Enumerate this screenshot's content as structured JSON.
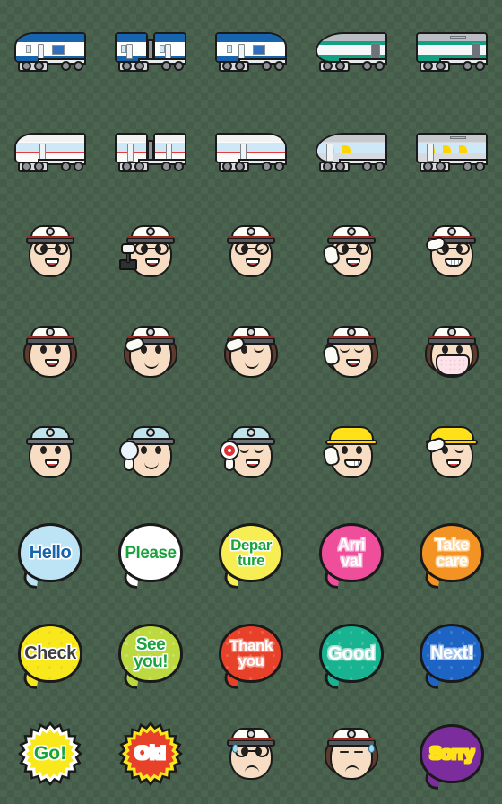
{
  "sheet": {
    "title": "Train & Station Staff Emoji Sticker Sheet",
    "columns": 5,
    "rows": 8,
    "cell_size_px": 112,
    "background": "transparent-checkerboard"
  },
  "palette": {
    "outline": "#1a1a1a",
    "train_blue": "#1663ae",
    "train_teal": "#13a184",
    "train_red_stripe": "#e33b3b",
    "cap_white": "#fdfdf7",
    "cap_blue": "#bfe4ec",
    "helmet_yellow": "#ffe11a",
    "skin": "#f7ddc3",
    "hair_brown": "#5e3b2c",
    "bubble_hello": "#bde4f4",
    "bubble_please": "#ffffff",
    "bubble_departure": "#f6ee52",
    "bubble_arrival": "#ef4e9b",
    "bubble_takecare": "#f39324",
    "bubble_check": "#f8e81c",
    "bubble_seeyou": "#bcd93f",
    "bubble_thankyou": "#e8412a",
    "bubble_good": "#18b391",
    "bubble_next": "#1d64c4",
    "badge_go": "#f8e81c",
    "badge_ok": "#e8412a",
    "bubble_sorry": "#7b2d9e"
  },
  "items": [
    {
      "row": 1,
      "col": 1,
      "name": "train-blue-front-left",
      "kind": "train",
      "label": "Blue commuter train front car (facing left)",
      "body": "#ffffff",
      "roof": "#1663ae",
      "accent": "#1663ae",
      "style": "nose-left"
    },
    {
      "row": 1,
      "col": 2,
      "name": "train-blue-coupled",
      "kind": "train",
      "label": "Blue commuter train coupled cars",
      "body": "#ffffff",
      "roof": "#1663ae",
      "accent": "#1663ae",
      "style": "coupled"
    },
    {
      "row": 1,
      "col": 3,
      "name": "train-blue-front-right",
      "kind": "train",
      "label": "Blue commuter train front car (facing right)",
      "body": "#ffffff",
      "roof": "#1663ae",
      "accent": "#1663ae",
      "style": "nose-right"
    },
    {
      "row": 1,
      "col": 4,
      "name": "train-teal-express-front",
      "kind": "train",
      "label": "Teal limited express front car",
      "body": "#13a184",
      "roof": "#b9bdc1",
      "accent": "#13a184",
      "style": "bullet-left"
    },
    {
      "row": 1,
      "col": 5,
      "name": "train-teal-express-car",
      "kind": "train",
      "label": "Teal limited express middle car",
      "body": "#13a184",
      "roof": "#b9bdc1",
      "accent": "#13a184",
      "style": "plain"
    },
    {
      "row": 2,
      "col": 1,
      "name": "train-white-red-front-left",
      "kind": "train",
      "label": "White train with red stripe, front car facing left",
      "body": "#fbfbfb",
      "roof": "#f2f2f2",
      "accent": "#e33b3b",
      "style": "nose-left-slope"
    },
    {
      "row": 2,
      "col": 2,
      "name": "train-white-red-coupled",
      "kind": "train",
      "label": "White train with red stripe, coupled cars",
      "body": "#fbfbfb",
      "roof": "#f2f2f2",
      "accent": "#e33b3b",
      "style": "coupled"
    },
    {
      "row": 2,
      "col": 3,
      "name": "train-white-red-front-right",
      "kind": "train",
      "label": "White train with red stripe, front car facing right",
      "body": "#fbfbfb",
      "roof": "#f2f2f2",
      "accent": "#e33b3b",
      "style": "nose-right-slope"
    },
    {
      "row": 2,
      "col": 4,
      "name": "train-silver-subway-front",
      "kind": "train",
      "label": "Silver subway car with yellow seats, front",
      "body": "#d7dade",
      "roof": "#c6cace",
      "accent": "#ffd400",
      "style": "round-left"
    },
    {
      "row": 2,
      "col": 5,
      "name": "train-silver-subway-car",
      "kind": "train",
      "label": "Silver subway middle car with yellow seats",
      "body": "#d7dade",
      "roof": "#c6cace",
      "accent": "#ffd400",
      "style": "plain"
    },
    {
      "row": 3,
      "col": 1,
      "name": "conductor-male-smiling",
      "kind": "face",
      "label": "Male conductor with glasses, smiling",
      "gender": "male",
      "cap": "white",
      "eyes": "open",
      "mouth": "smile",
      "glasses": true,
      "prop": "none"
    },
    {
      "row": 3,
      "col": 2,
      "name": "conductor-male-driving",
      "kind": "face",
      "label": "Male conductor with glasses operating control lever",
      "gender": "male",
      "cap": "white",
      "eyes": "open",
      "mouth": "smile",
      "glasses": true,
      "prop": "lever"
    },
    {
      "row": 3,
      "col": 3,
      "name": "conductor-male-winking",
      "kind": "face",
      "label": "Male conductor with glasses, winking",
      "gender": "male",
      "cap": "white",
      "eyes": "wink",
      "mouth": "smile",
      "glasses": true,
      "prop": "none"
    },
    {
      "row": 3,
      "col": 4,
      "name": "conductor-male-pointing",
      "kind": "face",
      "label": "Male conductor with glasses, pointing and calling",
      "gender": "male",
      "cap": "white",
      "eyes": "open",
      "mouth": "smile",
      "glasses": true,
      "prop": "point"
    },
    {
      "row": 3,
      "col": 5,
      "name": "conductor-male-saluting",
      "kind": "face",
      "label": "Male conductor with glasses, saluting and grinning",
      "gender": "male",
      "cap": "white",
      "eyes": "open",
      "mouth": "grin",
      "glasses": true,
      "prop": "salute"
    },
    {
      "row": 4,
      "col": 1,
      "name": "conductor-female-smiling",
      "kind": "face",
      "label": "Female conductor smiling",
      "gender": "female",
      "cap": "white",
      "eyes": "open",
      "mouth": "smile",
      "glasses": false,
      "prop": "none"
    },
    {
      "row": 4,
      "col": 2,
      "name": "conductor-female-saluting",
      "kind": "face",
      "label": "Female conductor saluting",
      "gender": "female",
      "cap": "white",
      "eyes": "open",
      "mouth": "arc",
      "glasses": false,
      "prop": "salute"
    },
    {
      "row": 4,
      "col": 3,
      "name": "conductor-female-winking",
      "kind": "face",
      "label": "Female conductor winking",
      "gender": "female",
      "cap": "white",
      "eyes": "wink",
      "mouth": "arc",
      "glasses": false,
      "prop": "salute"
    },
    {
      "row": 4,
      "col": 4,
      "name": "conductor-female-pointing",
      "kind": "face",
      "label": "Female conductor pointing and calling",
      "gender": "female",
      "cap": "white",
      "eyes": "closed-happy",
      "mouth": "smile",
      "glasses": false,
      "prop": "point"
    },
    {
      "row": 4,
      "col": 5,
      "name": "conductor-female-mask",
      "kind": "face",
      "label": "Female conductor wearing a face mask",
      "gender": "female",
      "cap": "white",
      "eyes": "open",
      "mouth": "mask",
      "glasses": false,
      "prop": "none"
    },
    {
      "row": 5,
      "col": 1,
      "name": "staff-bluecap-smiling",
      "kind": "face",
      "label": "Station staff in light blue cap, smiling",
      "gender": "male",
      "cap": "blue",
      "eyes": "open",
      "mouth": "smile",
      "glasses": false,
      "prop": "none"
    },
    {
      "row": 5,
      "col": 2,
      "name": "staff-bluecap-white-paddle",
      "kind": "face",
      "label": "Station staff in blue cap holding white signal paddle",
      "gender": "male",
      "cap": "blue",
      "eyes": "open",
      "mouth": "arc",
      "glasses": false,
      "prop": "paddle-white"
    },
    {
      "row": 5,
      "col": 3,
      "name": "staff-bluecap-red-paddle",
      "kind": "face",
      "label": "Station staff in blue cap holding red stop paddle",
      "gender": "male",
      "cap": "blue",
      "eyes": "closed-happy",
      "mouth": "smile",
      "glasses": false,
      "prop": "paddle-red"
    },
    {
      "row": 5,
      "col": 4,
      "name": "worker-helmet-pointing",
      "kind": "face",
      "label": "Worker in yellow helmet pointing, grinning",
      "gender": "male",
      "cap": "helmet",
      "eyes": "open",
      "mouth": "grin",
      "glasses": false,
      "prop": "point"
    },
    {
      "row": 5,
      "col": 5,
      "name": "worker-helmet-saluting",
      "kind": "face",
      "label": "Worker in yellow helmet saluting",
      "gender": "male",
      "cap": "helmet",
      "eyes": "wink",
      "mouth": "smile",
      "glasses": false,
      "prop": "salute"
    },
    {
      "row": 6,
      "col": 1,
      "name": "bubble-hello",
      "kind": "bubble",
      "label": "Hello speech bubble",
      "text_lines": [
        "Hello"
      ],
      "bg": "#bde4f4",
      "fg": "#1663ae",
      "stroke": "#ffffff",
      "stars": false,
      "font_px": 20
    },
    {
      "row": 6,
      "col": 2,
      "name": "bubble-please",
      "kind": "bubble",
      "label": "Please speech bubble",
      "text_lines": [
        "Please"
      ],
      "bg": "#ffffff",
      "fg": "#1aa33c",
      "stroke": "#ffffff",
      "stars": false,
      "font_px": 19
    },
    {
      "row": 6,
      "col": 3,
      "name": "bubble-departure",
      "kind": "bubble",
      "label": "Departure speech bubble",
      "text_lines": [
        "Depar",
        "ture"
      ],
      "bg": "#f6ee52",
      "fg": "#1aa33c",
      "stroke": "#ffffff",
      "stars": false,
      "font_px": 17
    },
    {
      "row": 6,
      "col": 4,
      "name": "bubble-arrival",
      "kind": "bubble",
      "label": "Arrival speech bubble",
      "text_lines": [
        "Arri",
        "val"
      ],
      "bg": "#ef4e9b",
      "fg": "#ffffff",
      "stroke": "#f9bede",
      "stars": false,
      "font_px": 18
    },
    {
      "row": 6,
      "col": 5,
      "name": "bubble-take-care",
      "kind": "bubble",
      "label": "Take care speech bubble",
      "text_lines": [
        "Take",
        "care"
      ],
      "bg": "#f39324",
      "fg": "#ffffff",
      "stroke": "#ffd8a5",
      "stars": false,
      "font_px": 18
    },
    {
      "row": 7,
      "col": 1,
      "name": "bubble-check",
      "kind": "bubble",
      "label": "Check speech bubble",
      "text_lines": [
        "Check"
      ],
      "bg": "#f8e81c",
      "fg": "#3e3e3e",
      "stroke": "#ffffff",
      "stars": true,
      "star_color": "#e4cf1a",
      "font_px": 20
    },
    {
      "row": 7,
      "col": 2,
      "name": "bubble-see-you",
      "kind": "bubble",
      "label": "See you! speech bubble",
      "text_lines": [
        "See",
        "you!"
      ],
      "bg": "#bcd93f",
      "fg": "#1aa33c",
      "stroke": "#ffffff",
      "stars": true,
      "star_color": "#d9ec74",
      "font_px": 19
    },
    {
      "row": 7,
      "col": 3,
      "name": "bubble-thank-you",
      "kind": "bubble",
      "label": "Thank you speech bubble",
      "text_lines": [
        "Thank",
        "you"
      ],
      "bg": "#e8412a",
      "fg": "#ffffff",
      "stroke": "#f7a79a",
      "stars": true,
      "star_color": "#f4776a",
      "font_px": 17
    },
    {
      "row": 7,
      "col": 4,
      "name": "bubble-good",
      "kind": "bubble",
      "label": "Good speech bubble",
      "text_lines": [
        "Good"
      ],
      "bg": "#18b391",
      "fg": "#ffffff",
      "stroke": "#9ee0d1",
      "stars": true,
      "star_color": "#5fc9b2",
      "font_px": 21
    },
    {
      "row": 7,
      "col": 5,
      "name": "bubble-next",
      "kind": "bubble",
      "label": "Next! speech bubble",
      "text_lines": [
        "Next!"
      ],
      "bg": "#1d64c4",
      "fg": "#ffffff",
      "stroke": "#a8c8f0",
      "stars": true,
      "star_color": "#5a92dd",
      "font_px": 20
    },
    {
      "row": 8,
      "col": 1,
      "name": "badge-go",
      "kind": "badge",
      "label": "Go! starburst badge",
      "text_lines": [
        "Go!"
      ],
      "bg": "#f8e81c",
      "ring": "#ffffff",
      "fg": "#1aa33c",
      "font_px": 21
    },
    {
      "row": 8,
      "col": 2,
      "name": "badge-ok",
      "kind": "badge",
      "label": "Ok! starburst badge",
      "text_lines": [
        "Ok!"
      ],
      "bg": "#e8412a",
      "ring": "#f8e81c",
      "fg": "#ffffff",
      "font_px": 21
    },
    {
      "row": 8,
      "col": 3,
      "name": "conductor-male-sad",
      "kind": "face",
      "label": "Male conductor with glasses looking troubled with sweat drop",
      "gender": "male",
      "cap": "white",
      "eyes": "open",
      "mouth": "sad",
      "glasses": true,
      "prop": "sweat"
    },
    {
      "row": 8,
      "col": 4,
      "name": "conductor-female-sad",
      "kind": "face",
      "label": "Female conductor looking troubled with sweat drop",
      "gender": "female",
      "cap": "white",
      "eyes": "closed-sad",
      "mouth": "sad",
      "glasses": false,
      "prop": "sweat"
    },
    {
      "row": 8,
      "col": 5,
      "name": "bubble-sorry",
      "kind": "bubble",
      "label": "Sorry speech bubble",
      "text_lines": [
        "Sorry"
      ],
      "bg": "#7b2d9e",
      "fg": "#ffe11a",
      "stroke": "#ffe11a",
      "stars": false,
      "font_px": 20
    }
  ]
}
